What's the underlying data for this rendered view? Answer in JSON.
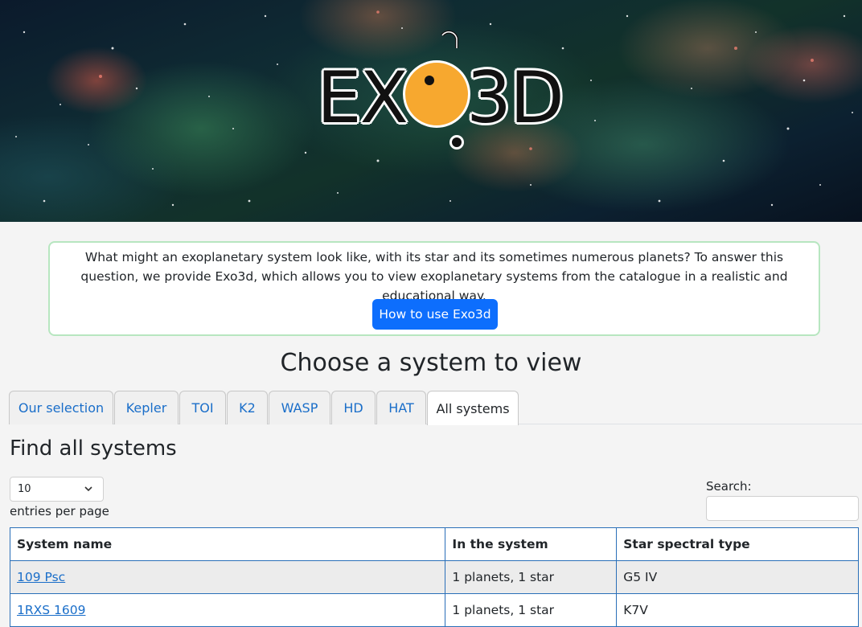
{
  "intro": {
    "text": "What might an exoplanetary system look like, with its star and its sometimes numerous planets? To answer this question, we provide Exo3d, which allows you to view exoplanetary systems from the catalogue in a realistic and educational way.",
    "button": "How to use Exo3d"
  },
  "logo": {
    "left": "EX",
    "right": "3D",
    "sun_color": "#f7a82f"
  },
  "choose_title": "Choose a system to view",
  "tabs": [
    {
      "label": "Our selection",
      "active": false
    },
    {
      "label": "Kepler",
      "active": false
    },
    {
      "label": "TOI",
      "active": false
    },
    {
      "label": "K2",
      "active": false
    },
    {
      "label": "WASP",
      "active": false
    },
    {
      "label": "HD",
      "active": false
    },
    {
      "label": "HAT",
      "active": false
    },
    {
      "label": "All systems",
      "active": true
    }
  ],
  "find_title": "Find all systems",
  "entries": {
    "selected": "10",
    "label": "entries per page"
  },
  "search": {
    "label": "Search:",
    "value": ""
  },
  "table": {
    "headers": [
      "System name",
      "In the system",
      "Star spectral type"
    ],
    "rows": [
      {
        "name": "109 Psc",
        "system": "1 planets, 1 star",
        "spectral": "G5 IV"
      },
      {
        "name": "1RXS 1609",
        "system": "1 planets, 1 star",
        "spectral": "K7V"
      }
    ]
  },
  "colors": {
    "accent": "#0d6efd",
    "link": "#1a6ec9",
    "card_border": "#b7e6c0",
    "table_border": "#2a6fb8"
  }
}
